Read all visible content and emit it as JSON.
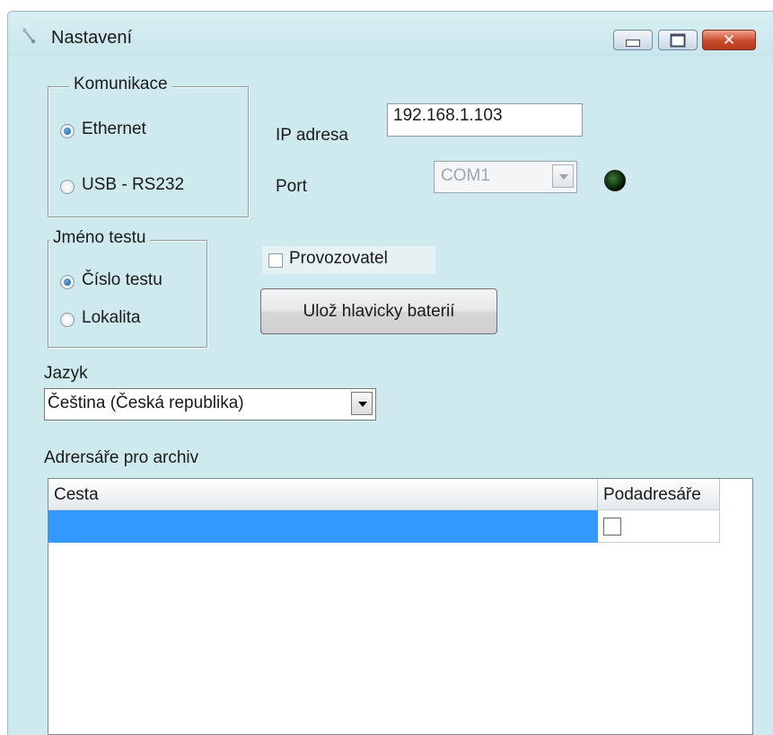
{
  "window": {
    "title": "Nastavení",
    "icon": "tool-icon"
  },
  "communication": {
    "legend": "Komunikace",
    "options": [
      {
        "label": "Ethernet",
        "selected": true
      },
      {
        "label": "USB - RS232",
        "selected": false
      }
    ],
    "ip_label": "IP adresa",
    "ip_value": "192.168.1.103",
    "port_label": "Port",
    "port_value": "COM1",
    "status_led": "dark-green"
  },
  "test_name": {
    "legend": "Jméno testu",
    "options": [
      {
        "label": "Číslo testu",
        "selected": true
      },
      {
        "label": "Lokalita",
        "selected": false
      }
    ]
  },
  "operator": {
    "label": "Provozovatel",
    "checked": false
  },
  "save_button": {
    "label": "Ulož hlavicky baterií"
  },
  "language": {
    "label": "Jazyk",
    "value": "Čeština (Česká republika)"
  },
  "archive": {
    "label": "Adrersáře pro archiv",
    "columns": [
      "Cesta",
      "Podadresáře"
    ],
    "rows": [
      {
        "path": "",
        "subdirs": false,
        "selected": true
      }
    ]
  },
  "colors": {
    "window_bg": "#cfeaee",
    "selection": "#3399ff",
    "close_button": "#c84a2c"
  }
}
